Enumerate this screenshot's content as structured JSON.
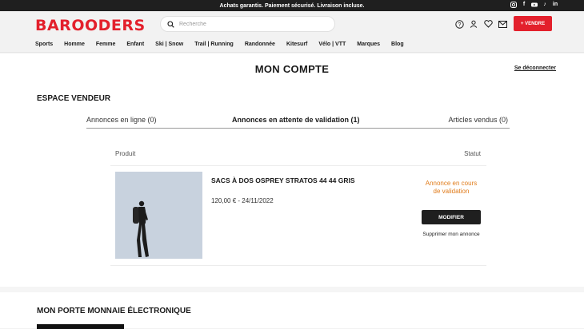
{
  "topbar": {
    "text": "Achats garantis. Paiement sécurisé. Livraison incluse.",
    "social": [
      "instagram-icon",
      "facebook-icon",
      "youtube-icon",
      "tiktok-icon",
      "linkedin-icon"
    ]
  },
  "header": {
    "logo": "BAROODERS",
    "search_placeholder": "Recherche",
    "sell_label": "+ VENDRE",
    "icons": [
      "help-icon",
      "user-icon",
      "heart-icon",
      "mail-icon"
    ]
  },
  "nav": [
    "Sports",
    "Homme",
    "Femme",
    "Enfant",
    "Ski | Snow",
    "Trail | Running",
    "Randonnée",
    "Kitesurf",
    "Vélo | VTT",
    "Marques",
    "Blog"
  ],
  "page": {
    "title": "MON COMPTE",
    "logout": "Se déconnecter",
    "seller_section": "ESPACE VENDEUR",
    "tabs": [
      "Annonces en ligne (0)",
      "Annonces en attente de validation (1)",
      "Articles vendus (0)"
    ],
    "active_tab": 1,
    "table": {
      "col_product": "Produit",
      "col_status": "Statut"
    },
    "product": {
      "name": "SACS À DOS OSPREY STRATOS 44 44 GRIS",
      "meta": "120,00 € - 24/11/2022",
      "status": "Annonce en cours de validation",
      "modify_label": "MODIFIER",
      "delete_label": "Supprimer mon annonce"
    },
    "wallet_section": "MON PORTE MONNAIE ÉLECTRONIQUE"
  },
  "colors": {
    "brand": "#e3202c",
    "status": "#e07b1a",
    "dark": "#1f1f1f"
  }
}
